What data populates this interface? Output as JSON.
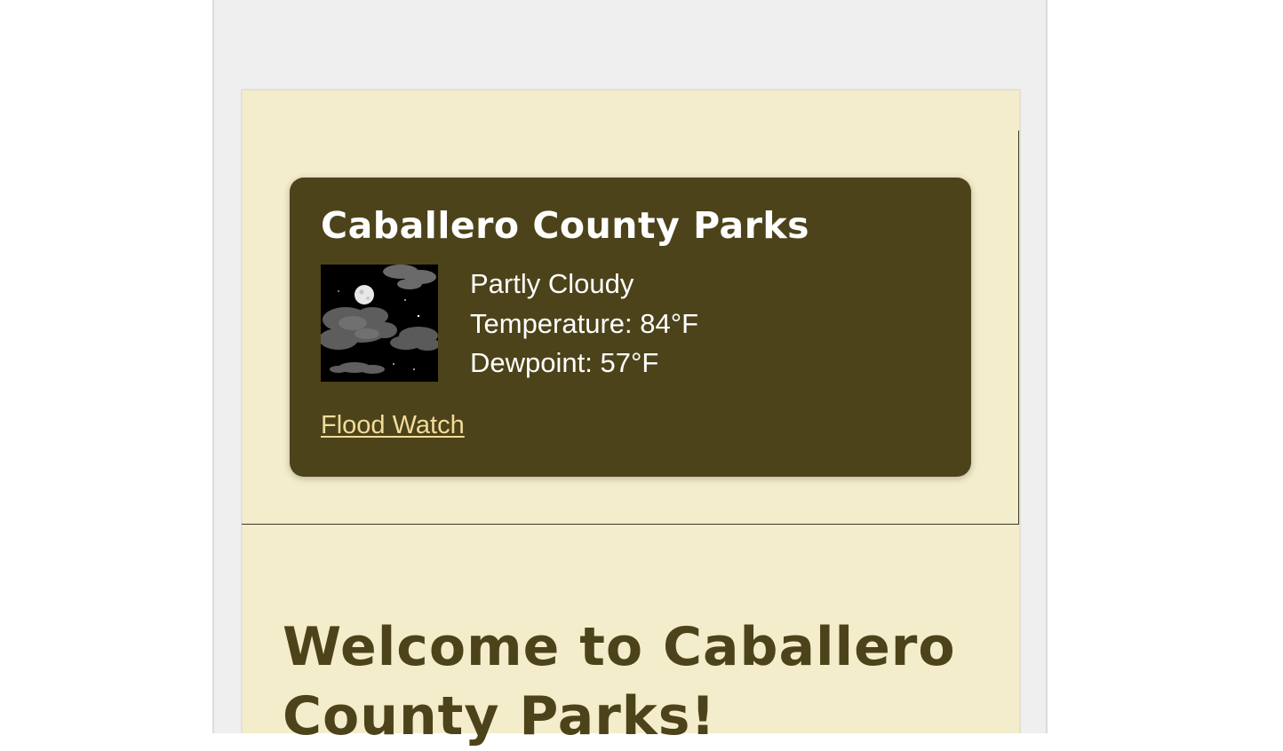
{
  "site": {
    "name": "Caballero County Parks"
  },
  "weather": {
    "icon": "night-partly-cloudy-moon-icon",
    "condition": "Partly Cloudy",
    "temperature": "Temperature: 84°F",
    "dewpoint": "Dewpoint: 57°F",
    "alert_label": "Flood Watch"
  },
  "main": {
    "welcome_heading": "Welcome to Caballero County Parks!"
  },
  "colors": {
    "page_background": "#efefef",
    "panel_background": "#f3edcc",
    "card_background": "#4d431a",
    "card_text": "#ffffff",
    "alert_link": "#f2dc9a",
    "heading_text": "#4d431a"
  }
}
